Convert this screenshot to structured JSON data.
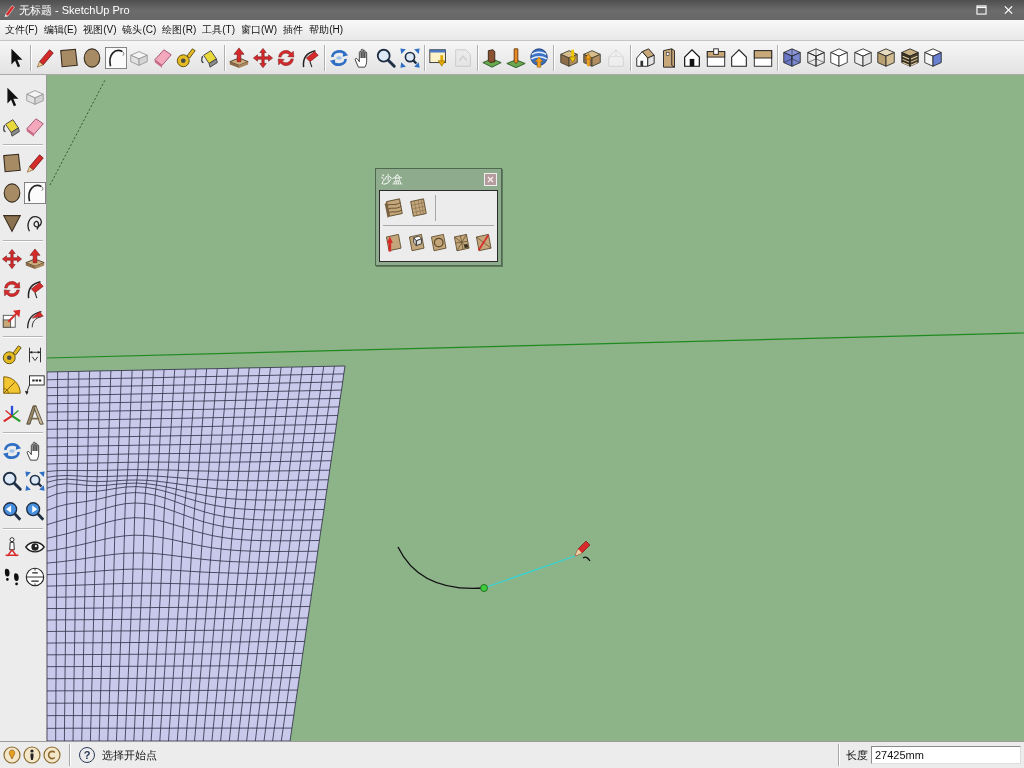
{
  "window": {
    "title": "无标题 - SketchUp Pro"
  },
  "menu": [
    {
      "label": "文件(F)"
    },
    {
      "label": "编辑(E)"
    },
    {
      "label": "视图(V)"
    },
    {
      "label": "镜头(C)"
    },
    {
      "label": "绘图(R)"
    },
    {
      "label": "工具(T)"
    },
    {
      "label": "窗口(W)"
    },
    {
      "label": "插件"
    },
    {
      "label": "帮助(H)"
    }
  ],
  "main_toolbar": [
    {
      "selected": false,
      "disabled": false
    },
    {
      "selected": false,
      "disabled": false
    },
    {
      "selected": false,
      "disabled": false
    },
    {
      "selected": false,
      "disabled": false
    },
    {
      "selected": true,
      "disabled": false
    },
    {
      "selected": false,
      "disabled": false
    },
    {
      "selected": false,
      "disabled": false
    },
    {
      "selected": false,
      "disabled": false
    },
    {
      "selected": false,
      "disabled": false
    },
    {
      "selected": false,
      "disabled": false
    },
    {
      "selected": false,
      "disabled": false
    },
    {
      "selected": false,
      "disabled": false
    },
    {
      "selected": false,
      "disabled": false
    },
    {
      "selected": false,
      "disabled": false
    },
    {
      "selected": false,
      "disabled": false
    },
    {
      "selected": false,
      "disabled": false
    },
    {
      "selected": false,
      "disabled": false
    },
    {
      "selected": false,
      "disabled": false
    },
    {
      "selected": false,
      "disabled": true
    },
    {
      "selected": false,
      "disabled": false
    },
    {
      "selected": false,
      "disabled": false
    },
    {
      "selected": false,
      "disabled": false
    },
    {
      "selected": false,
      "disabled": false
    },
    {
      "selected": false,
      "disabled": false
    },
    {
      "selected": false,
      "disabled": true
    },
    {
      "selected": false,
      "disabled": false
    },
    {
      "selected": false,
      "disabled": false
    },
    {
      "selected": false,
      "disabled": false
    },
    {
      "selected": false,
      "disabled": false
    },
    {
      "selected": false,
      "disabled": false
    },
    {
      "selected": false,
      "disabled": false
    },
    {
      "selected": false,
      "disabled": false
    },
    {
      "selected": false,
      "disabled": false
    },
    {
      "selected": false,
      "disabled": false
    },
    {
      "selected": false,
      "disabled": false
    },
    {
      "selected": false,
      "disabled": false
    },
    {
      "selected": false,
      "disabled": false
    },
    {
      "selected": false,
      "disabled": false
    }
  ],
  "side_toolbar": [
    {
      "selected": false
    },
    {
      "selected": false
    },
    {
      "selected": false
    },
    {
      "selected": false
    },
    {
      "selected": false
    },
    {
      "selected": false
    },
    {
      "selected": false
    },
    {
      "selected": true
    },
    {
      "selected": false
    },
    {
      "selected": false
    },
    {
      "selected": false
    },
    {
      "selected": false
    },
    {
      "selected": false
    },
    {
      "selected": false
    },
    {
      "selected": false
    },
    {
      "selected": false
    },
    {
      "selected": false
    },
    {
      "selected": false
    },
    {
      "selected": false
    },
    {
      "selected": false
    },
    {
      "selected": false
    },
    {
      "selected": false
    },
    {
      "selected": false
    },
    {
      "selected": false
    },
    {
      "selected": false
    },
    {
      "selected": false
    },
    {
      "selected": false
    },
    {
      "selected": false
    },
    {
      "selected": false
    },
    {
      "selected": false
    },
    {
      "selected": false
    },
    {
      "selected": false
    }
  ],
  "sandbox_panel": {
    "title": "沙盒"
  },
  "status_bar": {
    "help": "?",
    "hint": "选择开始点",
    "measure_label": "长度",
    "measure_value": "27425mm"
  }
}
